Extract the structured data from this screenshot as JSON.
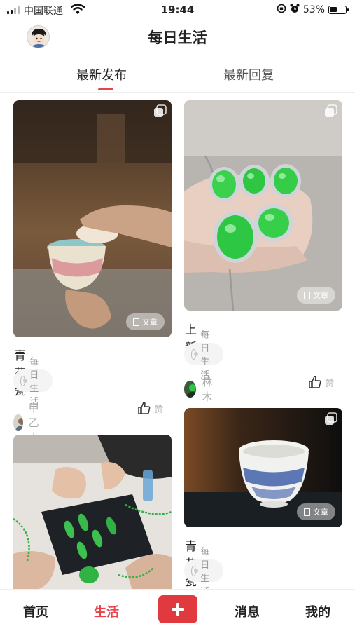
{
  "status_bar": {
    "carrier": "中国联通",
    "time": "19:44",
    "battery": "53%",
    "battery_level": 0.53
  },
  "header": {
    "title": "每日生活"
  },
  "tabs": [
    {
      "label": "最新发布",
      "active": true
    },
    {
      "label": "最新回复",
      "active": false
    }
  ],
  "feed": {
    "left": [
      {
        "title": "青花瓷",
        "tag": "每日生活",
        "author": "甲乙木",
        "like_label": "赞",
        "badge": "文章"
      },
      {
        "title": "",
        "tag": "",
        "author": "",
        "like_label": "",
        "badge": ""
      }
    ],
    "right": [
      {
        "title": "上新",
        "tag": "每日生活",
        "author": "林木",
        "like_label": "赞",
        "badge": "文章"
      },
      {
        "title": "青花瓷器",
        "tag": "每日生活",
        "author": "",
        "like_label": "",
        "badge": "文章"
      }
    ]
  },
  "bottom_nav": {
    "items": [
      "首页",
      "生活",
      "消息",
      "我的"
    ],
    "active": "生活"
  },
  "colors": {
    "accent": "#e8434a",
    "plus_button": "#e03a3e"
  }
}
